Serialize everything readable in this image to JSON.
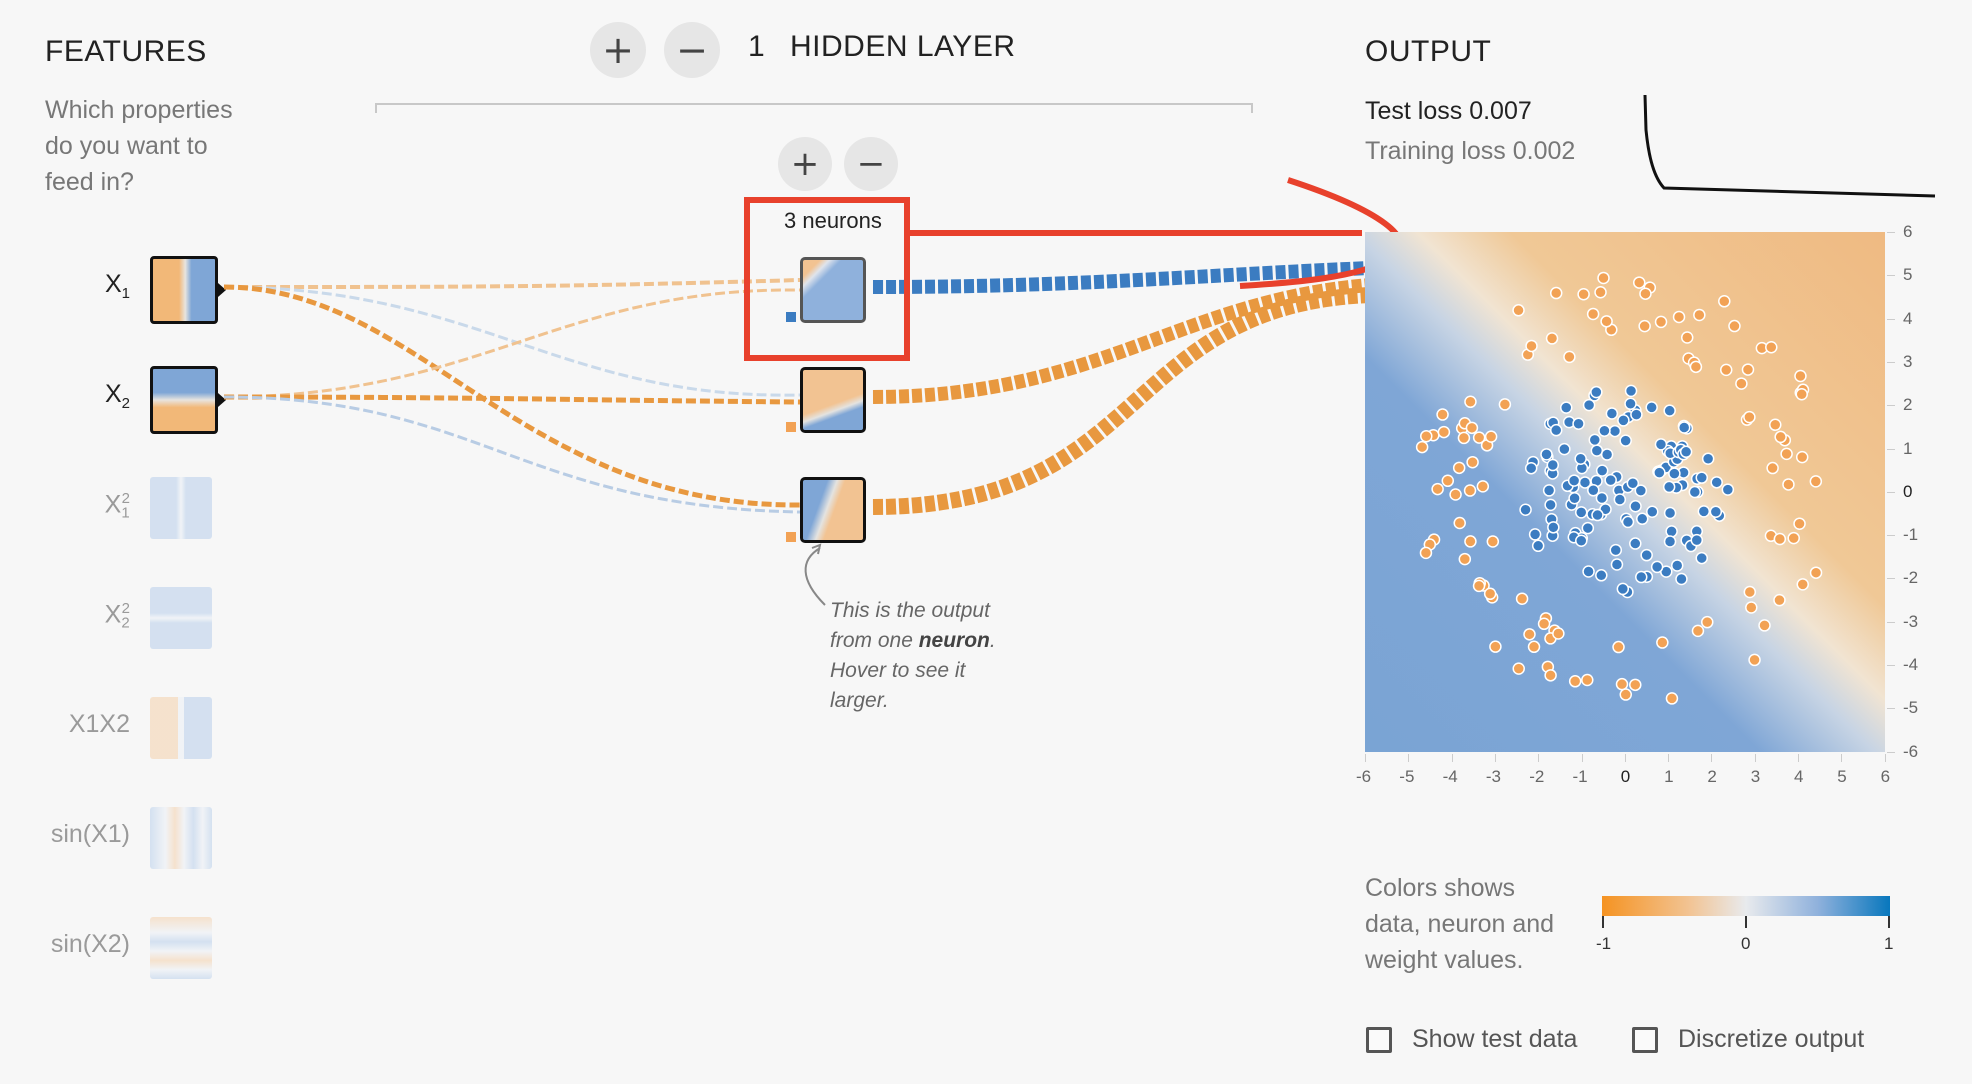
{
  "features_panel": {
    "title": "FEATURES",
    "question": [
      "Which properties",
      "do you want to",
      "feed in?"
    ],
    "items": [
      {
        "label": "X",
        "sub": "1",
        "sup": "",
        "active": true
      },
      {
        "label": "X",
        "sub": "2",
        "sup": "",
        "active": true
      },
      {
        "label": "X",
        "sub": "1",
        "sup": "2",
        "active": false
      },
      {
        "label": "X",
        "sub": "2",
        "sup": "2",
        "active": false
      },
      {
        "label": "X1X2",
        "sub": "",
        "sup": "",
        "active": false
      },
      {
        "label": "sin(X1)",
        "sub": "",
        "sup": "",
        "active": false
      },
      {
        "label": "sin(X2)",
        "sub": "",
        "sup": "",
        "active": false
      }
    ]
  },
  "hidden_layers": {
    "add_label": "+",
    "remove_label": "−",
    "count": "1",
    "title": "HIDDEN LAYER"
  },
  "layer": {
    "add_label": "+",
    "remove_label": "−",
    "neuron_count_label": "3 neurons"
  },
  "callout": {
    "line1": "This is the output",
    "line2_prefix": "from one ",
    "line2_bold": "neuron",
    "line2_suffix": ".",
    "line3": "Hover to see it",
    "line4": "larger."
  },
  "output": {
    "title": "OUTPUT",
    "test_loss_label": "Test loss 0.007",
    "training_loss_label": "Training loss 0.002",
    "x_ticks": [
      "-6",
      "-5",
      "-4",
      "-3",
      "-2",
      "-1",
      "0",
      "1",
      "2",
      "3",
      "4",
      "5",
      "6"
    ],
    "y_ticks": [
      "6",
      "5",
      "4",
      "3",
      "2",
      "1",
      "0",
      "-1",
      "-2",
      "-3",
      "-4",
      "-5",
      "-6"
    ]
  },
  "legend": {
    "text": [
      "Colors shows",
      "data, neuron and",
      "weight values."
    ],
    "min_label": "-1",
    "mid_label": "0",
    "max_label": "1"
  },
  "options": {
    "show_test_data_label": "Show test data",
    "show_test_data_checked": false,
    "discretize_output_label": "Discretize output",
    "discretize_output_checked": false
  },
  "colors": {
    "orange": "#f59322",
    "blue": "#0877bd",
    "annotation_red": "#e8412c"
  }
}
